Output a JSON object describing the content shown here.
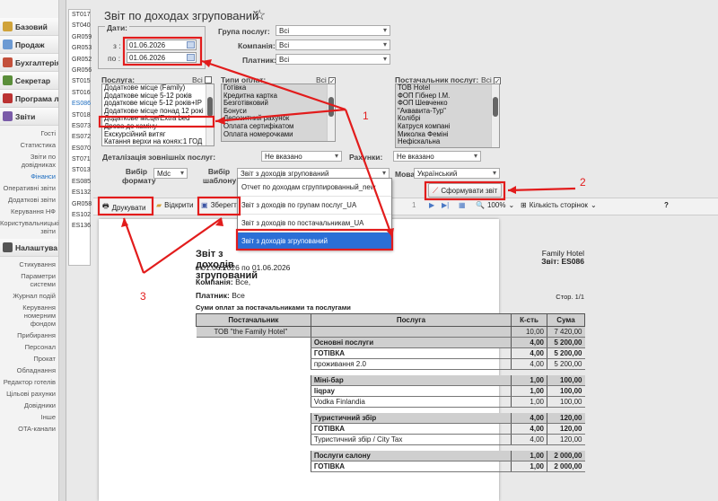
{
  "nav": {
    "sections": [
      {
        "label": "Базовий",
        "color": "#d0a33a"
      },
      {
        "label": "Продаж",
        "color": "#6c9ad3"
      },
      {
        "label": "Бухгалтерія",
        "color": "#c3503b"
      },
      {
        "label": "Секретар",
        "color": "#5a8e3a"
      },
      {
        "label": "Програма л",
        "color": "#b33"
      },
      {
        "label": "Звіти",
        "color": "#7a5ba8"
      }
    ],
    "reports_items": [
      "Гості",
      "Статистика",
      "Звіти по довідниках",
      "Фінанси",
      "Оперативні звіти",
      "Додаткові звіти",
      "Керування НФ",
      "Користувальницькі звіти"
    ],
    "settings_label": "Налаштува",
    "settings_items": [
      "Стикування",
      "Параметри системи",
      "Журнал подій",
      "Керування номерним фондом",
      "Прибирання",
      "Персонал",
      "Прокат",
      "Обладнання",
      "Редактор готелів",
      "Цільові рахунки",
      "Довідники",
      "Інше",
      "OTA-канали"
    ]
  },
  "codes": [
    "ST017",
    "ST040",
    "GR059",
    "GR053",
    "GR052",
    "GR056",
    "ST015",
    "ST016",
    "ES086",
    "ST018",
    "ES073",
    "ES072",
    "ES070",
    "ST071",
    "ST013",
    "ES085",
    "ES132",
    "GR058",
    "ES102",
    "ES136"
  ],
  "title": "Звіт по доходах згрупований",
  "dates": {
    "legend": "Дати:",
    "from_label": "з :",
    "from": "01.06.2026",
    "to_label": "по :",
    "to": "01.06.2026"
  },
  "filters": {
    "group_label": "Група послуг:",
    "group_value": "Всі",
    "company_label": "Компанія:",
    "company_value": "Всі",
    "payer_label": "Платник:",
    "payer_value": "Всі"
  },
  "services": {
    "label": "Послуга:",
    "all": "Всі",
    "items": [
      "Додаткове місце (Family)",
      "Додаткове місце 5-12 років",
      "додаткове місце 5-12 років+IP",
      "Додаткове місце понад 12 рокі",
      "Додаткове місце/Extra bed",
      "Дрова до каміну",
      "Екскурсійний витяг",
      "Катання верхи на конях:1 ГОД"
    ]
  },
  "pay_types": {
    "label": "Типи оплат:",
    "all": "Всі",
    "items": [
      "Готівка",
      "Кредитна картка",
      "Безготівковий",
      "Бонуси",
      "Депозитний рахунок",
      "Оплата сертифікатом",
      "Оплата номерочками"
    ]
  },
  "suppliers": {
    "label": "Постачальник послуг:",
    "all": "Всі",
    "items": [
      "ТОВ Hotel",
      "ФОП Гібнер І.М.",
      "ФОП Шевченко",
      "\"Аквавита-Тур\"",
      "Колібрі",
      "Катруся компані",
      "Миколка Феміні",
      "Нефіскальна"
    ]
  },
  "detail": {
    "label": "Деталізація зовнішніх послуг:",
    "value": "Не вказано",
    "accounts_label": "Рахунки:",
    "accounts_value": "Не вказано"
  },
  "format": {
    "label": "Вибір формату",
    "value": "Mdc"
  },
  "template": {
    "label": "Вибір шаблону",
    "value": "Звіт з доходів згрупований"
  },
  "language": {
    "label": "Мова",
    "value": "Український"
  },
  "generate_label": "Сформувати звіт",
  "dropdown": [
    "Отчет по доходам сгруппированный_new",
    "Звіт з доходів по групам послуг_UA",
    "Звіт з доходів по постачальникам_UA",
    "Звіт з доходів згрупований"
  ],
  "toolbar": {
    "print": "Друкувати",
    "open": "Відкрити",
    "save": "Зберегти",
    "page": "1",
    "zoom": "100%",
    "pages": "Кількість сторінок",
    "help": "?"
  },
  "report": {
    "title": "Звіт з доходів згрупований",
    "period": "з 01.06.2026 по 01.06.2026",
    "company_label": "Компанія:",
    "company_value": "Все,",
    "payer_label": "Платник:",
    "payer_value": "Все",
    "hotel": "Family Hotel",
    "code": "Звіт: ES086",
    "page": "Стор. 1/1",
    "section": "Суми оплат за постачальниками та послугами",
    "headers": [
      "Постачальник",
      "Послуга",
      "К-сть",
      "Сума"
    ],
    "rows": [
      {
        "t": "sup",
        "a": "ТОВ \"the Family Hotel\"",
        "b": "",
        "q": "10,00",
        "s": "7 420,00"
      },
      {
        "t": "grp",
        "a": "",
        "b": "Основні послуги",
        "q": "4,00",
        "s": "5 200,00"
      },
      {
        "t": "pay",
        "a": "",
        "b": "ГОТІВКА",
        "q": "4,00",
        "s": "5 200,00"
      },
      {
        "t": "itm",
        "a": "",
        "b": "проживання 2.0",
        "q": "4,00",
        "s": "5 200,00"
      },
      {
        "t": "gap"
      },
      {
        "t": "grp",
        "a": "",
        "b": "Міні-бар",
        "q": "1,00",
        "s": "100,00"
      },
      {
        "t": "pay",
        "a": "",
        "b": "liqpay",
        "q": "1,00",
        "s": "100,00"
      },
      {
        "t": "itm",
        "a": "",
        "b": "Vodka Finlandia",
        "q": "1,00",
        "s": "100,00"
      },
      {
        "t": "gap"
      },
      {
        "t": "grp",
        "a": "",
        "b": "Туристичний збір",
        "q": "4,00",
        "s": "120,00"
      },
      {
        "t": "pay",
        "a": "",
        "b": "ГОТІВКА",
        "q": "4,00",
        "s": "120,00"
      },
      {
        "t": "itm",
        "a": "",
        "b": "Туристичний збір / City Tax",
        "q": "4,00",
        "s": "120,00"
      },
      {
        "t": "gap"
      },
      {
        "t": "grp",
        "a": "",
        "b": "Послуги салону",
        "q": "1,00",
        "s": "2 000,00"
      },
      {
        "t": "pay",
        "a": "",
        "b": "ГОТІВКА",
        "q": "1,00",
        "s": "2 000,00"
      }
    ]
  },
  "annotations": [
    "1",
    "2",
    "3"
  ],
  "colors": {
    "annotation": "#e21c1c",
    "highlight": "#2b6fd6"
  }
}
